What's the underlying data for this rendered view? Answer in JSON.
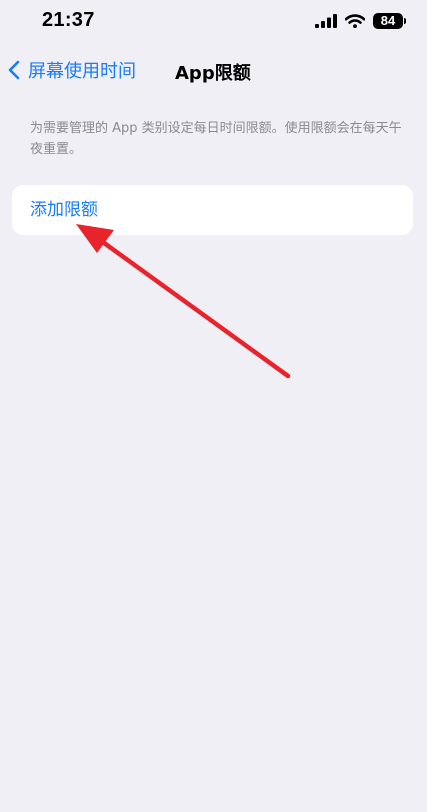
{
  "status_bar": {
    "time": "21:37",
    "battery": "84",
    "icons": [
      "signal-icon",
      "wifi-icon",
      "battery-icon"
    ]
  },
  "nav": {
    "back_label": "屏幕使用时间",
    "title": "App限额"
  },
  "description": "为需要管理的 App 类别设定每日时间限额。使用限额会在每天午夜重置。",
  "card": {
    "add_limit_label": "添加限额"
  },
  "colors": {
    "background": "#f0eff5",
    "accent": "#1a7cf6",
    "annotation_arrow": "#e8232b"
  }
}
